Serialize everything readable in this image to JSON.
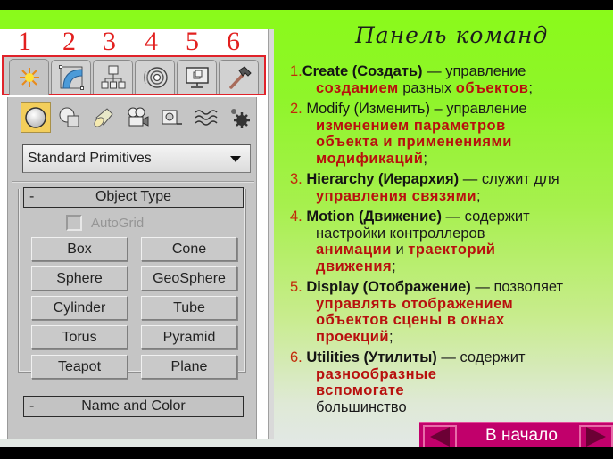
{
  "slide_title": "Панель команд",
  "callout_numbers": [
    "1",
    "2",
    "3",
    "4",
    "5",
    "6"
  ],
  "panel": {
    "tabs": [
      {
        "name": "create",
        "icon": "sun-burst-icon",
        "active": true
      },
      {
        "name": "modify",
        "icon": "bent-pipe-icon",
        "active": false
      },
      {
        "name": "hierarchy",
        "icon": "hierarchy-tree-icon",
        "active": false
      },
      {
        "name": "motion",
        "icon": "motion-wheel-icon",
        "active": false
      },
      {
        "name": "display",
        "icon": "monitor-icon",
        "active": false
      },
      {
        "name": "utilities",
        "icon": "hammer-icon",
        "active": false
      }
    ],
    "subcategories": [
      {
        "name": "geometry",
        "icon": "sphere-icon",
        "active": true
      },
      {
        "name": "shapes",
        "icon": "shapes-icon",
        "active": false
      },
      {
        "name": "lights",
        "icon": "spotlight-icon",
        "active": false
      },
      {
        "name": "cameras",
        "icon": "camera-icon",
        "active": false
      },
      {
        "name": "helpers",
        "icon": "tape-measure-icon",
        "active": false
      },
      {
        "name": "space-warps",
        "icon": "waves-icon",
        "active": false
      },
      {
        "name": "systems",
        "icon": "gears-icon",
        "active": false
      }
    ],
    "dropdown_value": "Standard Primitives",
    "object_type": {
      "header": "Object Type",
      "collapse_symbol": "-",
      "autogrid_label": "AutoGrid",
      "autogrid_checked": false,
      "buttons": [
        "Box",
        "Cone",
        "Sphere",
        "GeoSphere",
        "Cylinder",
        "Tube",
        "Torus",
        "Pyramid",
        "Teapot",
        "Plane"
      ]
    },
    "name_and_color": {
      "header": "Name and Color",
      "collapse_symbol": "-"
    }
  },
  "items": [
    {
      "num": "1.",
      "key": "Create (Создать)",
      "dash": " — управление",
      "lines": [
        [
          {
            "t": "созданием",
            "r": true
          },
          {
            "t": " разных ",
            "r": false
          },
          {
            "t": "объектов",
            "r": true
          },
          {
            "t": ";",
            "r": false
          }
        ]
      ]
    },
    {
      "num": "2.",
      "key": " Modify (Изменить)",
      "dash": " – управление",
      "lines": [
        [
          {
            "t": "изменением параметров",
            "r": true
          }
        ],
        [
          {
            "t": "объекта и применениями",
            "r": true
          }
        ],
        [
          {
            "t": "модификаций",
            "r": true
          },
          {
            "t": ";",
            "r": false
          }
        ]
      ]
    },
    {
      "num": "3.",
      "key": " Hierarchy (Иерархия)",
      "dash": " — служит для",
      "lines": [
        [
          {
            "t": "управления связями",
            "r": true
          },
          {
            "t": ";",
            "r": false
          }
        ]
      ]
    },
    {
      "num": "4.",
      "key": " Motion (Движение)",
      "dash": " — содержит",
      "lines": [
        [
          {
            "t": "настройки контроллеров",
            "r": false
          }
        ],
        [
          {
            "t": "анимации",
            "r": true
          },
          {
            "t": " и ",
            "r": false
          },
          {
            "t": "траекторий",
            "r": true
          }
        ],
        [
          {
            "t": "движения",
            "r": true
          },
          {
            "t": ";",
            "r": false
          }
        ]
      ]
    },
    {
      "num": "5.",
      "key": " Display (Отображение)",
      "dash": " — позволяет",
      "lines": [
        [
          {
            "t": "управлять отображением",
            "r": true
          }
        ],
        [
          {
            "t": "объектов сцены в окнах",
            "r": true
          }
        ],
        [
          {
            "t": "проекций",
            "r": true
          },
          {
            "t": ";",
            "r": false
          }
        ]
      ]
    },
    {
      "num": "6.",
      "key": " Utilities (Утилиты)",
      "dash": " — содержит",
      "lines": [
        [
          {
            "t": "разнообразные",
            "r": true
          }
        ],
        [
          {
            "t": "вспомогате",
            "r": true
          }
        ],
        [
          {
            "t": "большинство",
            "r": false
          }
        ]
      ]
    }
  ],
  "nav": {
    "home_label": "В начало",
    "prev_icon": "triangle-left-icon",
    "next_icon": "triangle-right-icon"
  },
  "colors": {
    "accent_red": "#b8100e",
    "callout_red": "#e2201f",
    "nav_magenta": "#c1006b",
    "background_green": "#8afa1a"
  }
}
